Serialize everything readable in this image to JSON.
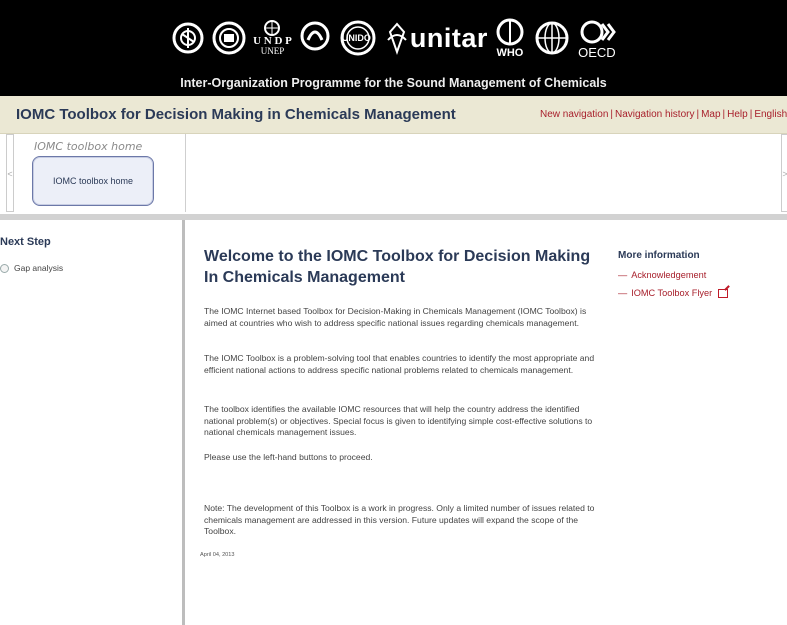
{
  "banner": {
    "logos": [
      {
        "icon": "fao-logo-icon"
      },
      {
        "icon": "ilo-logo-icon"
      },
      {
        "icon": "undp-logo-icon",
        "text": "U N D P",
        "sub": "UNEP"
      },
      {
        "icon": "unep-logo-icon"
      },
      {
        "icon": "unido-logo-icon",
        "text": "UNIDO"
      },
      {
        "icon": "unitar-logo-icon",
        "text": "unitar"
      },
      {
        "icon": "who-logo-icon",
        "text": "WHO"
      },
      {
        "icon": "un-globe-logo-icon"
      },
      {
        "icon": "oecd-logo-icon",
        "text": "OECD"
      }
    ],
    "subtitle": "Inter-Organization Programme for the Sound Management of Chemicals"
  },
  "titlebar": {
    "title": "IOMC Toolbox for Decision Making in Chemicals Management",
    "links": [
      "New navigation",
      "Navigation history",
      "Map",
      "Help",
      "English"
    ]
  },
  "navstrip": {
    "caption": "IOMC toolbox home",
    "home_button": "IOMC toolbox home",
    "prev": "<",
    "next": ">"
  },
  "sidebar": {
    "heading": "Next Step",
    "options": [
      "Gap analysis"
    ]
  },
  "content": {
    "title": "Welcome to the IOMC Toolbox for Decision Making In Chemicals Management",
    "paragraphs": [
      "The IOMC Internet based Toolbox for Decision-Making in Chemicals Management (IOMC Toolbox) is aimed at countries who wish to address specific national issues regarding chemicals management.",
      "The IOMC Toolbox is a problem-solving tool that enables countries to identify the most appropriate and efficient national actions to address specific national problems related to chemicals management.",
      "The toolbox identifies the available IOMC resources that will help the country address the identified national problem(s) or objectives. Special focus is given to identifying simple cost-effective solutions to national chemicals management issues.",
      "Please use the left-hand buttons to proceed.",
      "Note: The development of this Toolbox is a work in progress. Only a limited number of issues related to chemicals management are addressed in this version. Future updates will expand the scope of the Toolbox."
    ],
    "date": "April 04, 2013"
  },
  "moreinfo": {
    "title": "More information",
    "links": [
      {
        "label": "Acknowledgement",
        "external": false
      },
      {
        "label": "IOMC Toolbox Flyer",
        "external": true
      }
    ]
  },
  "colors": {
    "accent_link": "#a8202c",
    "title_navy": "#2b3a57",
    "titlebar_bg": "#ebe8d4"
  }
}
